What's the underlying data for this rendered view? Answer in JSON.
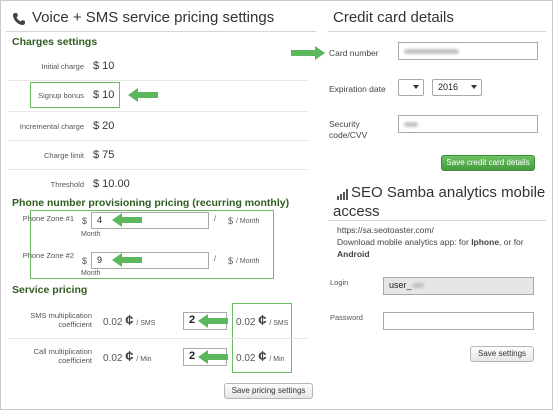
{
  "voice_panel": {
    "icon": "phone-icon",
    "title": "Voice + SMS service pricing settings",
    "charges_heading": "Charges settings",
    "charges": [
      {
        "label": "Initial charge",
        "value": "$ 10"
      },
      {
        "label": "Signup bonus",
        "value": "$ 10"
      },
      {
        "label": "Incremental charge",
        "value": "$ 20"
      },
      {
        "label": "Charge limit",
        "value": "$ 75"
      },
      {
        "label": "Threshold",
        "value": "$ 10.00"
      }
    ],
    "provisioning_heading": "Phone number provisioning pricing (recurring monthly)",
    "zones": [
      {
        "label": "Phone Zone #1",
        "currency": "$",
        "value": "4",
        "slash": "/",
        "month_label": "Month",
        "result_currency": "$",
        "result_unit": "/ Month"
      },
      {
        "label": "Phone Zone #2",
        "currency": "$",
        "value": "9",
        "slash": "/",
        "month_label": "Month",
        "result_currency": "$",
        "result_unit": "/ Month"
      }
    ],
    "service_heading": "Service pricing",
    "services": [
      {
        "label": "SMS multiplication coefficient",
        "base": "0.02",
        "unit": "/ SMS",
        "multiplier": "2",
        "result": "0.02",
        "result_unit": "/ SMS"
      },
      {
        "label": "Call multiplication coefficient",
        "base": "0.02",
        "unit": "/ Min",
        "multiplier": "2",
        "result": "0.02",
        "result_unit": "/ Min"
      }
    ],
    "cent_symbol": "¢",
    "save_button": "Save pricing settings"
  },
  "credit_panel": {
    "title": "Credit card details",
    "card_number_label": "Card number",
    "expiration_label": "Expiration date",
    "expiration_month": "",
    "expiration_year": "2016",
    "security_label": "Security code/CVV",
    "save_button": "Save credit card details"
  },
  "samba_panel": {
    "icon": "signal-bars-icon",
    "title": "SEO Samba analytics mobile access",
    "url": "https://sa.seotoaster.com/",
    "download_text": "Download mobile analytics app: for ",
    "iphone": "Iphone",
    "or_for": ", or for",
    "android": "Android",
    "login_label": "Login",
    "login_value": "user_",
    "password_label": "Password",
    "save_button": "Save settings"
  },
  "colors": {
    "accent_green": "#5cb85c",
    "box_border": "#6dbb63",
    "heading_green": "#2f5c1f"
  }
}
